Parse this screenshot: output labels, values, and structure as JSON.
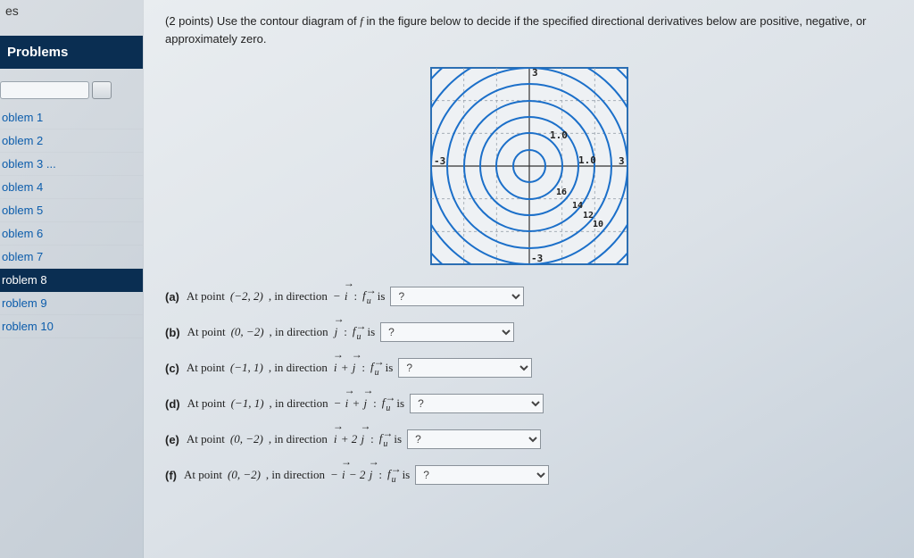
{
  "sidebar": {
    "corner": "es",
    "header": "Problems",
    "items": [
      {
        "label": "oblem 1"
      },
      {
        "label": "oblem 2"
      },
      {
        "label": "oblem 3 ..."
      },
      {
        "label": "oblem 4"
      },
      {
        "label": "oblem 5"
      },
      {
        "label": "oblem 6"
      },
      {
        "label": "oblem 7"
      },
      {
        "label": "roblem 8"
      },
      {
        "label": "roblem 9"
      },
      {
        "label": "roblem 10"
      }
    ],
    "active_index": 7
  },
  "question": {
    "points_prefix": "(2 points) ",
    "text_1": "Use the contour diagram of ",
    "func": "f",
    "text_2": " in the figure below to decide if the specified directional derivatives below are positive, negative, or approximately zero."
  },
  "contour": {
    "x_ticks": [
      "-3",
      "1.0",
      "3"
    ],
    "y_ticks": [
      "3",
      "1.0",
      "-3"
    ],
    "level_labels": [
      "16",
      "14",
      "12",
      "10"
    ]
  },
  "parts": [
    {
      "key": "a",
      "label": "(a)",
      "point": "(−2, 2)",
      "dir_prefix": "−",
      "dir_terms": [
        "i"
      ],
      "dir_sep": []
    },
    {
      "key": "b",
      "label": "(b)",
      "point": "(0, −2)",
      "dir_prefix": "",
      "dir_terms": [
        "j"
      ],
      "dir_sep": []
    },
    {
      "key": "c",
      "label": "(c)",
      "point": "(−1, 1)",
      "dir_prefix": "",
      "dir_terms": [
        "i",
        "j"
      ],
      "dir_sep": [
        " + "
      ]
    },
    {
      "key": "d",
      "label": "(d)",
      "point": "(−1, 1)",
      "dir_prefix": "−",
      "dir_terms": [
        "i",
        "j"
      ],
      "dir_sep": [
        " + "
      ]
    },
    {
      "key": "e",
      "label": "(e)",
      "point": "(0, −2)",
      "dir_prefix": "",
      "dir_terms": [
        "i",
        "j"
      ],
      "dir_sep": [
        " + 2"
      ]
    },
    {
      "key": "f",
      "label": "(f)",
      "point": "(0, −2)",
      "dir_prefix": "−",
      "dir_terms": [
        "i",
        "j"
      ],
      "dir_sep": [
        " − 2"
      ]
    }
  ],
  "strings": {
    "at_point": "At point ",
    "in_direction": ", in direction ",
    "colon_f": ":   ",
    "is": " is ",
    "select_placeholder": "?"
  },
  "chart_data": {
    "type": "contour",
    "title": "",
    "xlim": [
      -3,
      3
    ],
    "ylim": [
      -3,
      3
    ],
    "center": [
      0,
      0
    ],
    "levels": [
      {
        "value": 16,
        "radius": 1.0
      },
      {
        "value": 14,
        "radius": 1.5
      },
      {
        "value": 12,
        "radius": 2.0
      },
      {
        "value": 10,
        "radius": 2.5
      }
    ],
    "unlabeled_radii": [
      0.5,
      3.0,
      3.5,
      4.0
    ],
    "xlabel": "",
    "ylabel": ""
  }
}
